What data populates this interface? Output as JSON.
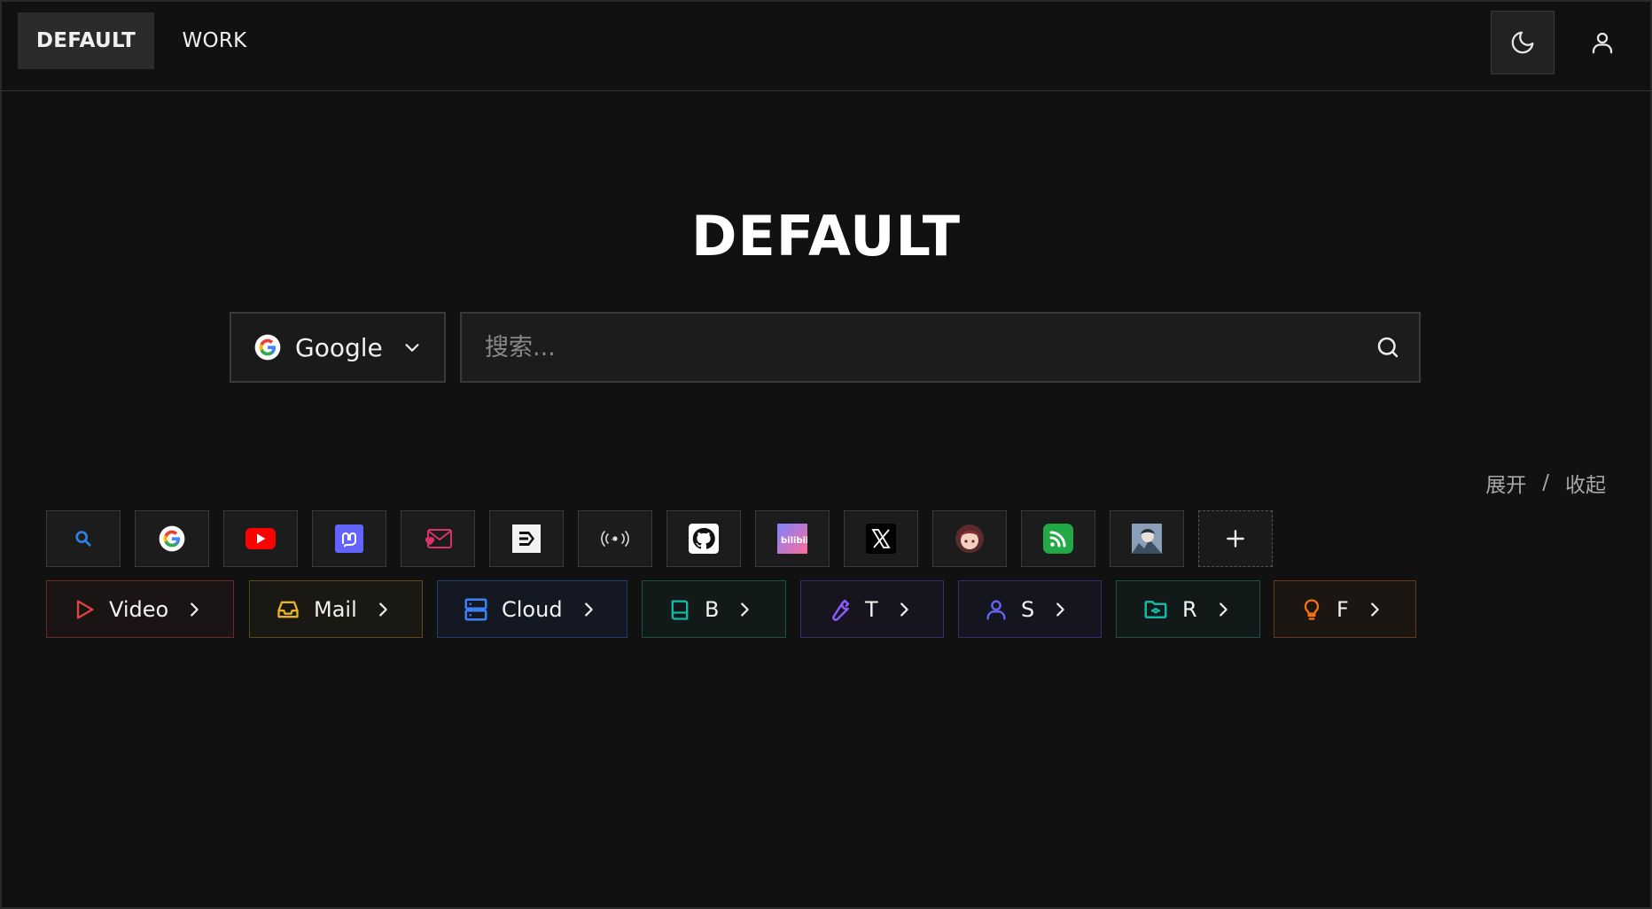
{
  "tabs": [
    {
      "label": "DEFAULT",
      "active": true
    },
    {
      "label": "WORK",
      "active": false
    }
  ],
  "header": {
    "theme_icon": "moon-icon",
    "user_icon": "user-icon"
  },
  "title": "DEFAULT",
  "search": {
    "engine": "Google",
    "placeholder": "搜索..."
  },
  "toggle": {
    "expand": "展开",
    "separator": "/",
    "collapse": "收起"
  },
  "bookmarks": [
    {
      "name": "search-site-icon"
    },
    {
      "name": "google-icon"
    },
    {
      "name": "youtube-icon"
    },
    {
      "name": "mastodon-icon"
    },
    {
      "name": "mail-heart-icon"
    },
    {
      "name": "e-logo-icon"
    },
    {
      "name": "broadcast-icon"
    },
    {
      "name": "github-icon"
    },
    {
      "name": "bilibili-icon"
    },
    {
      "name": "x-icon"
    },
    {
      "name": "avatar-anime-icon"
    },
    {
      "name": "rss-icon"
    },
    {
      "name": "avatar-character-icon"
    },
    {
      "name": "add-icon"
    }
  ],
  "categories": [
    {
      "label": "Video",
      "icon": "play-icon",
      "color": "#e0453e"
    },
    {
      "label": "Mail",
      "icon": "inbox-icon",
      "color": "#e6b422"
    },
    {
      "label": "Cloud",
      "icon": "server-icon",
      "color": "#3b82f6"
    },
    {
      "label": "B",
      "icon": "book-icon",
      "color": "#14b8a6"
    },
    {
      "label": "T",
      "icon": "wrench-icon",
      "color": "#8b5cf6"
    },
    {
      "label": "S",
      "icon": "user-icon",
      "color": "#6366f1"
    },
    {
      "label": "R",
      "icon": "folder-icon",
      "color": "#14b8a6"
    },
    {
      "label": "F",
      "icon": "bulb-icon",
      "color": "#f97316"
    }
  ]
}
